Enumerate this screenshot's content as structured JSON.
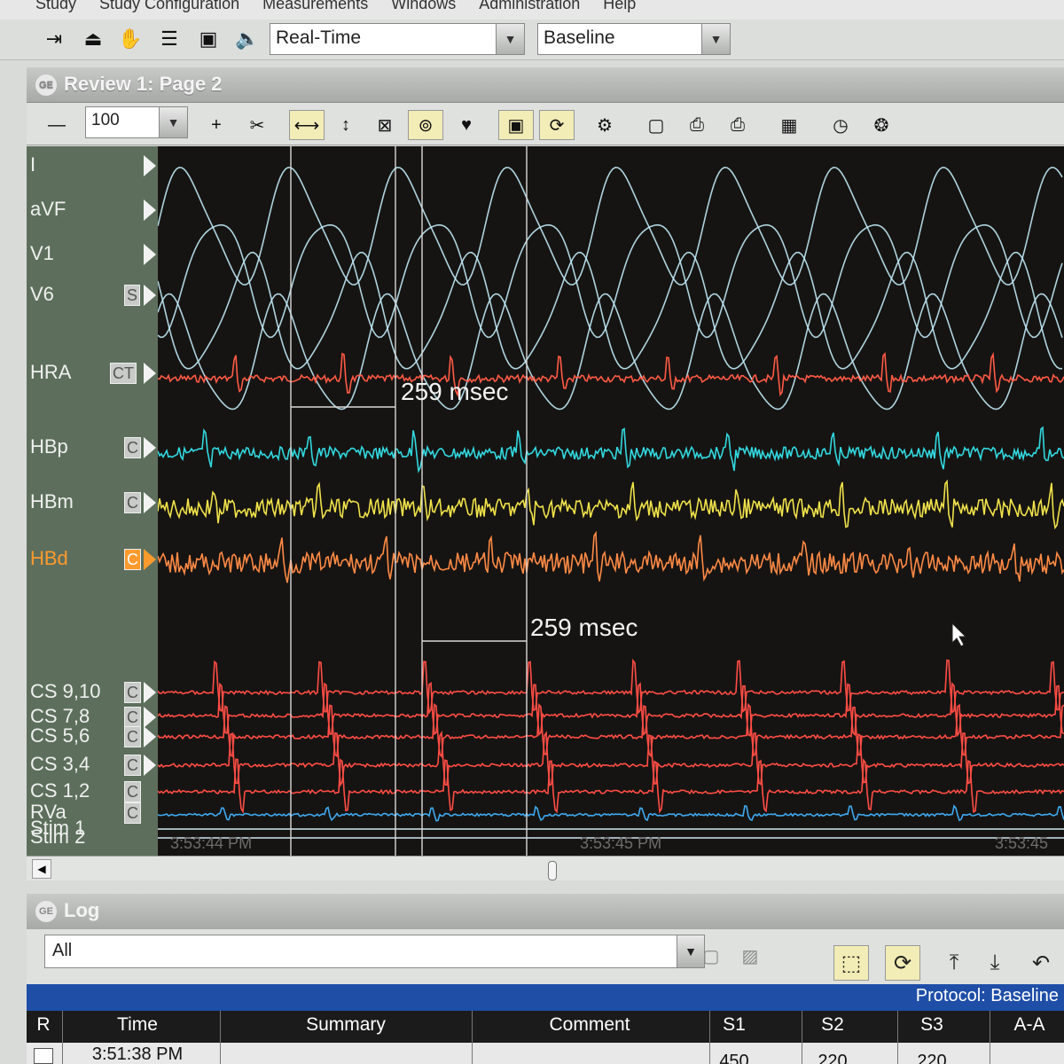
{
  "menu": [
    "Study",
    "Study Configuration",
    "Measurements",
    "Windows",
    "Administration",
    "Help"
  ],
  "toolbar": {
    "mode_value": "Real-Time",
    "phase_value": "Baseline",
    "icons": [
      "exit-icon",
      "record-icon",
      "hand-icon",
      "notes-icon",
      "monitor-icon",
      "speaker-icon"
    ]
  },
  "review": {
    "title": "Review 1: Page 2",
    "zoom_value": "100",
    "icons": [
      "minus-icon",
      "plus-icon",
      "tools-icon",
      "horizontal-caliper-icon",
      "vertical-caliper-icon",
      "delete-caliper-icon",
      "march-caliper-icon",
      "heart-caliper-icon",
      "display-icon",
      "sync-icon",
      "channel-config-icon",
      "camera-icon",
      "print-preview-icon",
      "print-icon",
      "table-icon",
      "clock-icon",
      "settings-wheel-icon"
    ]
  },
  "channels": [
    {
      "label": "I",
      "tag": "",
      "color": "#bfe8f5"
    },
    {
      "label": "aVF",
      "tag": "",
      "color": "#bfe8f5"
    },
    {
      "label": "V1",
      "tag": "",
      "color": "#bfe8f5"
    },
    {
      "label": "V6",
      "tag": "S",
      "color": "#bfe8f5"
    },
    {
      "label": "HRA",
      "tag": "CT",
      "color": "#ff5a45"
    },
    {
      "label": "HBp",
      "tag": "C",
      "color": "#32d8e0"
    },
    {
      "label": "HBm",
      "tag": "C",
      "color": "#f0e24a"
    },
    {
      "label": "HBd",
      "tag": "C",
      "color": "#ff8a45"
    },
    {
      "label": "CS 9,10",
      "tag": "C",
      "color": "#ff4d45"
    },
    {
      "label": "CS 7,8",
      "tag": "C",
      "color": "#ff4d45"
    },
    {
      "label": "CS 5,6",
      "tag": "C",
      "color": "#ff4d45"
    },
    {
      "label": "CS 3,4",
      "tag": "C",
      "color": "#ff4d45"
    },
    {
      "label": "CS 1,2",
      "tag": "C",
      "color": "#ff4d45"
    },
    {
      "label": "RVa",
      "tag": "C",
      "color": "#3fa9f0"
    },
    {
      "label": "Stim 1",
      "tag": "",
      "color": "#bfe8f5"
    },
    {
      "label": "Stim 2",
      "tag": "",
      "color": "#bfe8f5"
    }
  ],
  "measurements": [
    "259 msec",
    "259 msec"
  ],
  "timestamps": [
    "3:53:44 PM",
    "3:53:45 PM",
    "3:53:45"
  ],
  "log": {
    "title": "Log",
    "filter_value": "All",
    "protocol_label": "Protocol: Baseline",
    "columns": [
      "R",
      "Time",
      "Summary",
      "Comment",
      "S1",
      "S2",
      "S3",
      "A-A"
    ],
    "rows": [
      {
        "time": "3:51:38 PM",
        "summary": "",
        "comment": "",
        "s1": "450",
        "s2": "220",
        "s3": "220",
        "aa": ""
      }
    ]
  }
}
